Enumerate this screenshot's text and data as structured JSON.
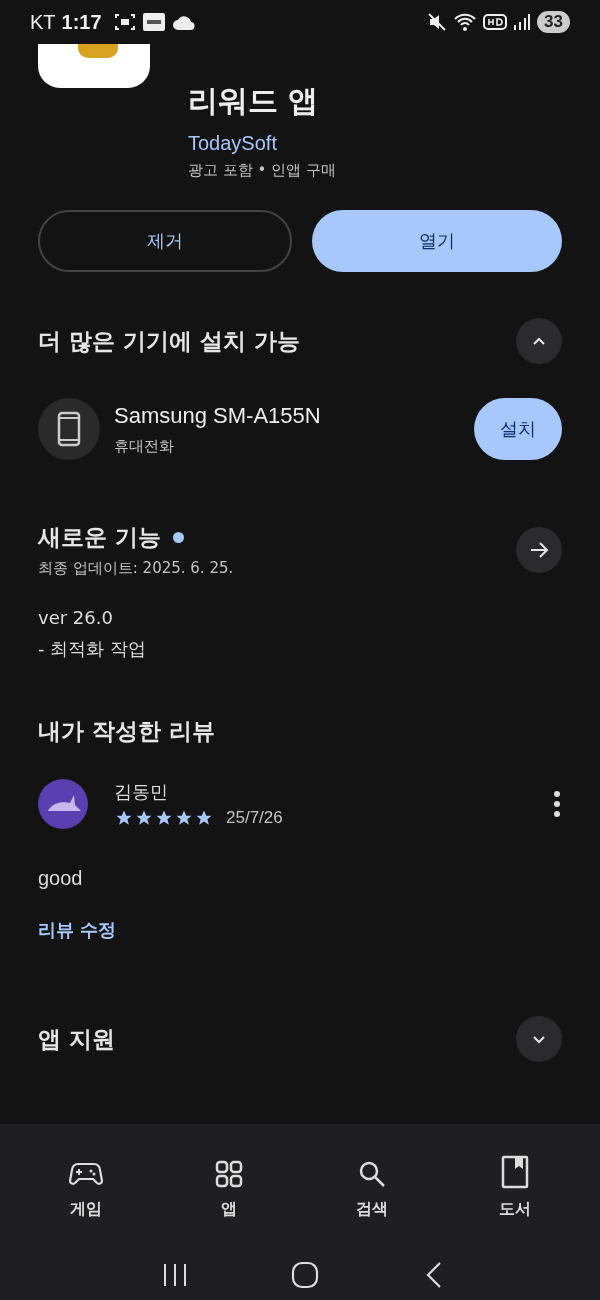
{
  "status_bar": {
    "carrier": "KT",
    "time": "1:17",
    "battery": "33"
  },
  "app": {
    "title": "리워드 앱",
    "developer": "TodaySoft",
    "meta": "광고 포함 • 인앱 구매"
  },
  "actions": [
    {
      "label": "제거",
      "kind": "outline"
    },
    {
      "label": "열기",
      "kind": "filled"
    }
  ],
  "devices_section": {
    "title": "더 많은 기기에 설치 가능",
    "expanded": true,
    "device": {
      "name": "Samsung SM-A155N",
      "type": "휴대전화",
      "button": "설치"
    }
  },
  "whats_new": {
    "title": "새로운 기능",
    "updated": "최종 업데이트: 2025. 6. 25.",
    "notes": [
      "ver 26.0",
      "- 최적화 작업"
    ]
  },
  "my_review": {
    "title": "내가 작성한 리뷰",
    "author": "김동민",
    "stars": 5,
    "date": "25/7/26",
    "text": "good",
    "edit_link": "리뷰 수정"
  },
  "app_support": {
    "title": "앱 지원",
    "expanded": false
  },
  "bottom_nav": [
    {
      "label": "게임",
      "kind": "game"
    },
    {
      "label": "앱",
      "kind": "apps"
    },
    {
      "label": "검색",
      "kind": "search"
    },
    {
      "label": "도서",
      "kind": "book"
    }
  ]
}
